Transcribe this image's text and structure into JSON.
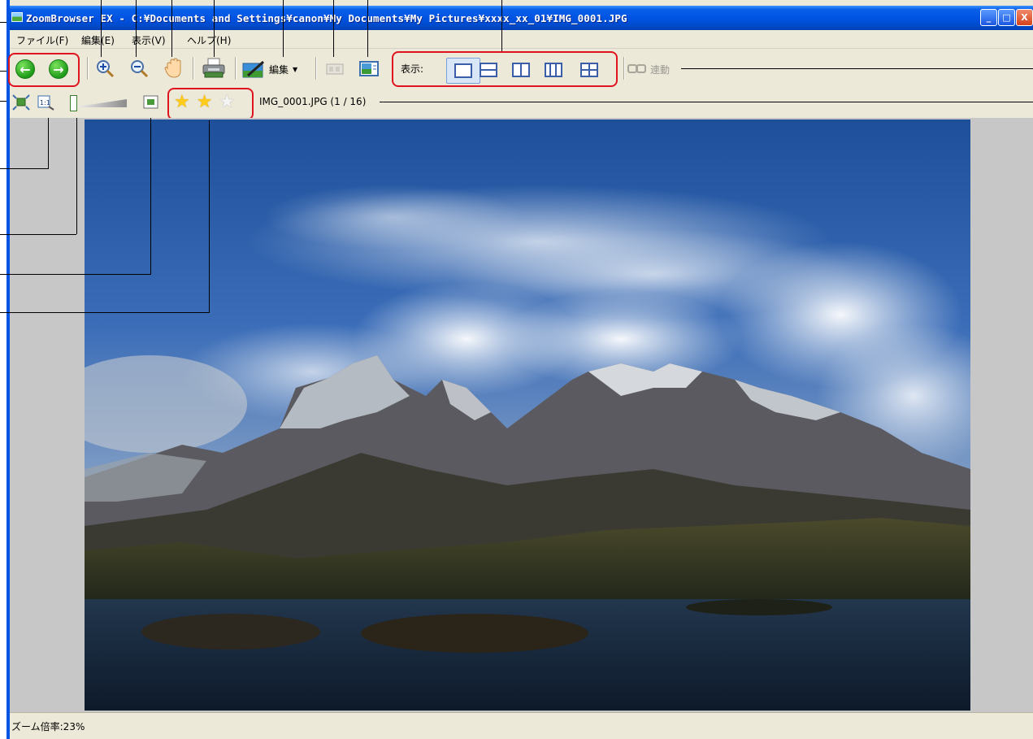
{
  "window": {
    "title": "ZoomBrowser EX - C:¥Documents and Settings¥canon¥My Documents¥My Pictures¥xxxx_xx_01¥IMG_0001.JPG"
  },
  "window_controls": {
    "minimize": "_",
    "maximize": "□",
    "close": "X"
  },
  "menu": {
    "file": "ファイル(F)",
    "edit": "編集(E)",
    "view": "表示(V)",
    "help": "ヘルプ(H)"
  },
  "toolbar": {
    "prev_icon": "arrow-left-icon",
    "next_icon": "arrow-right-icon",
    "zoom_in_icon": "zoom-in-icon",
    "zoom_out_icon": "zoom-out-icon",
    "pan_icon": "hand-icon",
    "print_icon": "printer-icon",
    "edit_label": "編集",
    "view_label": "表示:",
    "link_label": "連動"
  },
  "toolbar2": {
    "filename": "IMG_0001.JPG (1 / 16)",
    "rating": 2,
    "rating_max": 3
  },
  "status": {
    "zoom": "ズーム倍率:23%"
  },
  "colors": {
    "title_bar": "#0054e3",
    "highlight": "#e0141e",
    "chrome": "#ece9d8"
  }
}
